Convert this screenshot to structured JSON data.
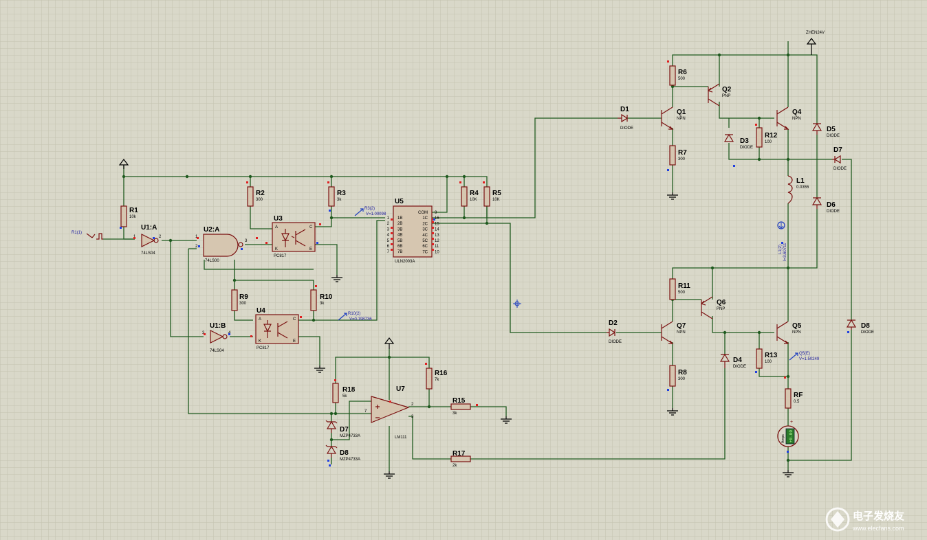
{
  "inputs": {
    "pulse": "R1(1)",
    "supply_net": "ZHEN24V"
  },
  "resistors": [
    {
      "ref": "R1",
      "value": "10k"
    },
    {
      "ref": "R2",
      "value": "300"
    },
    {
      "ref": "R3",
      "value": "3k"
    },
    {
      "ref": "R4",
      "value": "10K"
    },
    {
      "ref": "R5",
      "value": "10K"
    },
    {
      "ref": "R6",
      "value": "500"
    },
    {
      "ref": "R7",
      "value": "300"
    },
    {
      "ref": "R8",
      "value": "300"
    },
    {
      "ref": "R9",
      "value": "300"
    },
    {
      "ref": "R10",
      "value": "3k"
    },
    {
      "ref": "R11",
      "value": "500"
    },
    {
      "ref": "R12",
      "value": "100"
    },
    {
      "ref": "R13",
      "value": "100"
    },
    {
      "ref": "R15",
      "value": "3k"
    },
    {
      "ref": "R16",
      "value": "7k"
    },
    {
      "ref": "R17",
      "value": "2k"
    },
    {
      "ref": "R18",
      "value": "5k"
    },
    {
      "ref": "RF",
      "value": "0.5"
    }
  ],
  "gates": [
    {
      "ref": "U1:A",
      "part": "74LS04"
    },
    {
      "ref": "U1:B",
      "part": "74LS04"
    },
    {
      "ref": "U2:A",
      "part": "74LS00"
    }
  ],
  "optos": [
    {
      "ref": "U3",
      "part": "PC817"
    },
    {
      "ref": "U4",
      "part": "PC817"
    }
  ],
  "driver": {
    "ref": "U5",
    "part": "ULN2003A",
    "left_pins": [
      "1B",
      "2B",
      "3B",
      "4B",
      "5B",
      "6B",
      "7B"
    ],
    "right_pins": [
      "COM",
      "1C",
      "2C",
      "3C",
      "4C",
      "5C",
      "6C",
      "7C"
    ],
    "left_nums": [
      "1",
      "2",
      "3",
      "4",
      "5",
      "6",
      "7"
    ],
    "right_nums": [
      "9",
      "16",
      "15",
      "14",
      "13",
      "12",
      "11",
      "10"
    ]
  },
  "comparator": {
    "ref": "U7",
    "part": "LM111"
  },
  "diodes": [
    {
      "ref": "D1",
      "part": "DIODE"
    },
    {
      "ref": "D2",
      "part": "DIODE"
    },
    {
      "ref": "D3",
      "part": "DIODE"
    },
    {
      "ref": "D4",
      "part": "DIODE"
    },
    {
      "ref": "D5",
      "part": "DIODE"
    },
    {
      "ref": "D6",
      "part": "DIODE"
    },
    {
      "ref": "D7r",
      "label": "D7",
      "part": "DIODE"
    },
    {
      "ref": "D8r",
      "label": "D8",
      "part": "DIODE"
    },
    {
      "ref": "D7z",
      "label": "D7",
      "part": "MZP4733A"
    },
    {
      "ref": "D8z",
      "label": "D8",
      "part": "MZP4733A"
    }
  ],
  "transistors": [
    {
      "ref": "Q1",
      "type": "NPN"
    },
    {
      "ref": "Q2",
      "type": "PNP"
    },
    {
      "ref": "Q4",
      "type": "NPN"
    },
    {
      "ref": "Q5",
      "type": "NPN"
    },
    {
      "ref": "Q6",
      "type": "PNP"
    },
    {
      "ref": "Q7",
      "type": "NPN"
    }
  ],
  "inductor": {
    "ref": "L1",
    "value": "0.0355"
  },
  "probes": [
    {
      "name": "R3(2)",
      "value": "V=1.00098"
    },
    {
      "name": "R10(2)",
      "value": "V=0.198736"
    },
    {
      "name": "Q5(E)",
      "value": "V=1.50249"
    },
    {
      "name": "L1(2)",
      "value": "I=3.60711"
    }
  ],
  "ammeter": {
    "unit": "Amps",
    "reading": "+0.00"
  },
  "watermark": {
    "cn": "电子发烧友",
    "url": "www.elecfans.com"
  }
}
